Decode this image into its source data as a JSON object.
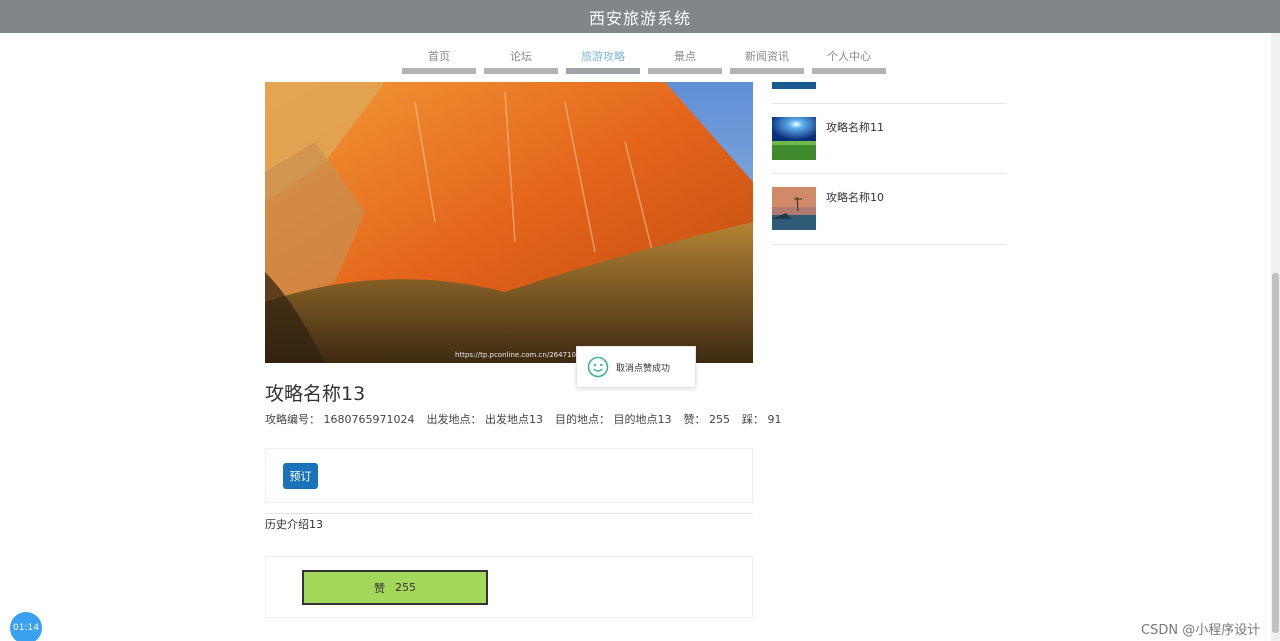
{
  "header": {
    "title": "西安旅游系统"
  },
  "nav": {
    "items": [
      {
        "label": "首页"
      },
      {
        "label": "论坛"
      },
      {
        "label": "旅游攻略"
      },
      {
        "label": "景点"
      },
      {
        "label": "新闻资讯"
      },
      {
        "label": "个人中心"
      }
    ],
    "active": "旅游攻略"
  },
  "hero": {
    "watermark": "https://tp.pconline.com.cn/26471081/"
  },
  "toast": {
    "message": "取消点赞成功",
    "icon": "smile-icon"
  },
  "article": {
    "title": "攻略名称13",
    "meta": {
      "id_label": "攻略编号：",
      "id_value": "1680765971024",
      "from_label": "出发地点：",
      "from_value": "出发地点13",
      "to_label": "目的地点：",
      "to_value": "目的地点13",
      "like_label": "赞：",
      "like_value": "255",
      "dislike_label": "踩：",
      "dislike_value": "91"
    },
    "book_button": "预订",
    "history": "历史介绍13",
    "like_button_label": "赞",
    "like_button_count": "255"
  },
  "sidebar": {
    "items": [
      {
        "label": "攻略名称11"
      },
      {
        "label": "攻略名称10"
      }
    ]
  },
  "timer": "01:14",
  "watermark": "CSDN @小程序设计",
  "colors": {
    "topbar": "#81868b",
    "nav_active": "#7ab7da",
    "book_button": "#1a73b8",
    "like_button": "#a4d85b"
  }
}
